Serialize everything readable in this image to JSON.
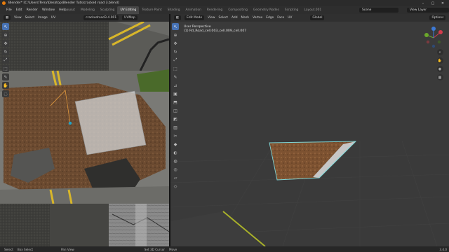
{
  "window": {
    "title": "Blender* [C:\\Users\\Terry\\Desktop\\Blender Tuts\\cracked road 3.blend]"
  },
  "menu": [
    "File",
    "Edit",
    "Render",
    "Window",
    "Help"
  ],
  "workspaces": [
    {
      "label": "Layout",
      "active": false
    },
    {
      "label": "Modeling",
      "active": false
    },
    {
      "label": "Sculpting",
      "active": false
    },
    {
      "label": "UV Editing",
      "active": true
    },
    {
      "label": "Texture Paint",
      "active": false
    },
    {
      "label": "Shading",
      "active": false
    },
    {
      "label": "Animation",
      "active": false
    },
    {
      "label": "Rendering",
      "active": false
    },
    {
      "label": "Compositing",
      "active": false
    },
    {
      "label": "Geometry Nodes",
      "active": false
    },
    {
      "label": "Scripting",
      "active": false
    },
    {
      "label": "Layout.001",
      "active": false
    }
  ],
  "scene": {
    "label": "Scene"
  },
  "view_layer": {
    "label": "View Layer"
  },
  "uv_editor": {
    "header": [
      "View",
      "Select",
      "Image",
      "UV"
    ],
    "image_name": "crackedroad3-4.001",
    "uvmap": "UVMap"
  },
  "viewport": {
    "mode": "Edit Mode",
    "header": [
      "View",
      "Select",
      "Add",
      "Mesh",
      "Vertex",
      "Edge",
      "Face",
      "UV"
    ],
    "transform": "Global",
    "perspective": "User Perspective",
    "object_info": "(1) Rd_Road_cell.003_cell.009_cell.007",
    "options": "Options"
  },
  "status_bar": {
    "items": [
      "Select",
      "Box Select",
      "Pan View",
      "Set 3D Cursor",
      "Move"
    ],
    "version": "3.4.0"
  },
  "colors": {
    "accent": "#4772b3",
    "uv_edge": "#f1a33f",
    "face_sel": "#e7b85a"
  }
}
